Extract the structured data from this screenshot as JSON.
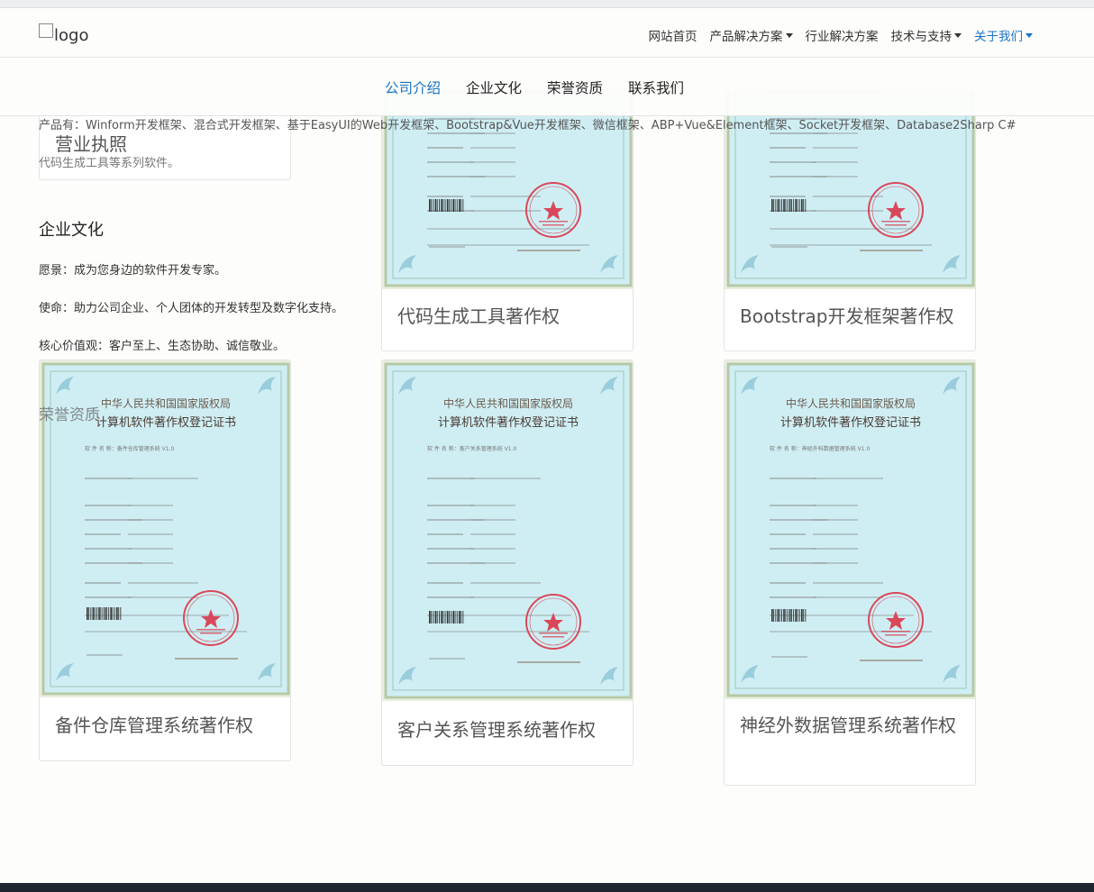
{
  "nav": {
    "logo_text": "logo",
    "items": [
      {
        "label": "网站首页",
        "dropdown": false,
        "active": false
      },
      {
        "label": "产品解决方案",
        "dropdown": true,
        "active": false
      },
      {
        "label": "行业解决方案",
        "dropdown": false,
        "active": false
      },
      {
        "label": "技术与支持",
        "dropdown": true,
        "active": false
      },
      {
        "label": "关于我们",
        "dropdown": true,
        "active": true
      }
    ],
    "active_color": "#1a73c4"
  },
  "subnav": {
    "tabs": [
      {
        "label": "公司介绍",
        "active": true
      },
      {
        "label": "企业文化",
        "active": false
      },
      {
        "label": "荣誉资质",
        "active": false
      },
      {
        "label": "联系我们",
        "active": false
      }
    ]
  },
  "intro": {
    "products_line": "产品有：Winform开发框架、混合式开发框架、基于EasyUI的Web开发框架、Bootstrap&Vue开发框架、微信框架、ABP+Vue&Element框架、Socket开发框架、Database2Sharp C#",
    "products_line_tail": "代码生成工具等系列软件。"
  },
  "culture": {
    "title": "企业文化",
    "vision": "愿景：成为您身边的软件开发专家。",
    "mission": "使命：助力公司企业、个人团体的开发转型及数字化支持。",
    "values": "核心价值观：客户至上、生态协助、诚信敬业。"
  },
  "honors": {
    "title": "荣誉资质",
    "business_license": "营业执照",
    "certificates": [
      {
        "caption": "代码生成工具著作权",
        "software": "代码生成工具软件"
      },
      {
        "caption": "Bootstrap开发框架著作权",
        "software": "Bootstrap开发框架"
      },
      {
        "caption": "备件仓库管理系统著作权",
        "software": "备件仓库管理系统 V1.0"
      },
      {
        "caption": "客户关系管理系统著作权",
        "software": "客户关系管理系统 V1.0"
      },
      {
        "caption": "神经外数据管理系统著作权",
        "software": "神经外科数据管理系统 V1.0"
      }
    ],
    "cert_header_1": "中华人民共和国国家版权局",
    "cert_header_2": "计算机软件著作权登记证书",
    "stamp_text": "计算机软件著作权登记专用章"
  },
  "colors": {
    "cert_bg": "#cfeef4",
    "cert_border": "#b7c9a6",
    "stamp": "#d9485a"
  }
}
